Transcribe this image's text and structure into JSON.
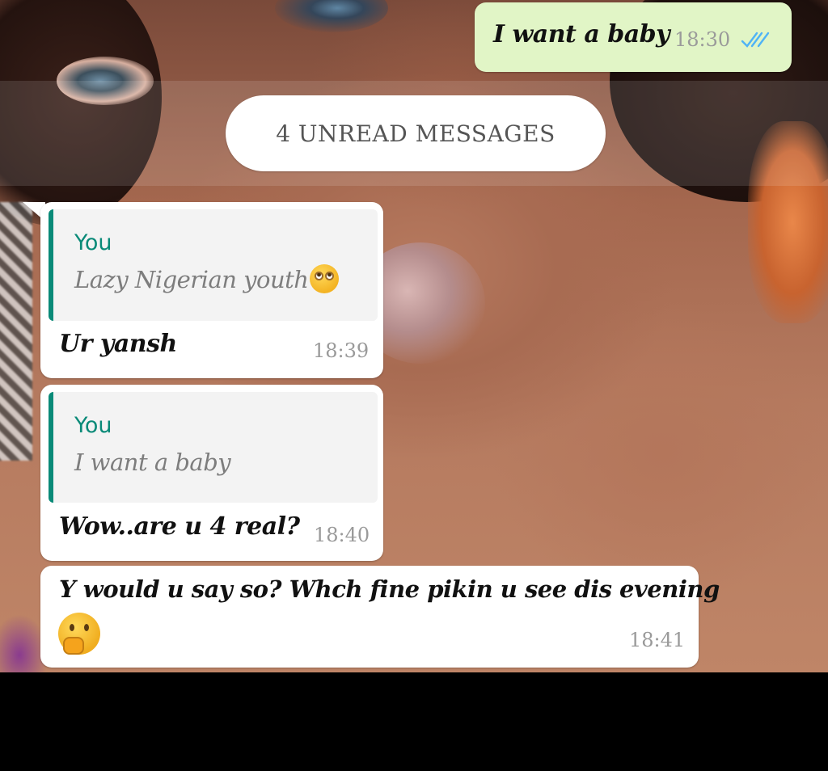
{
  "messages": {
    "outgoing_1": {
      "text": "I want a baby",
      "time": "18:30",
      "status": "read"
    },
    "unread_divider": "4 UNREAD MESSAGES",
    "incoming_1": {
      "quote_author": "You",
      "quote_text": "Lazy Nigerian youth",
      "quote_emoji": "face-with-rolling-eyes-icon",
      "text": "Ur yansh",
      "time": "18:39"
    },
    "incoming_2": {
      "quote_author": "You",
      "quote_text": "I want a baby",
      "text": "Wow..are u 4 real?",
      "time": "18:40"
    },
    "incoming_3": {
      "text": "Y would u say so? Whch fine pikin u see dis evening",
      "emoji": "thinking-face-icon",
      "time": "18:41"
    }
  },
  "colors": {
    "outgoing_bubble": "#e1f5c6",
    "incoming_bubble": "#ffffff",
    "quote_accent": "#0a8a78",
    "read_ticks": "#4fb3f6",
    "timestamp": "#9a9a9a"
  }
}
